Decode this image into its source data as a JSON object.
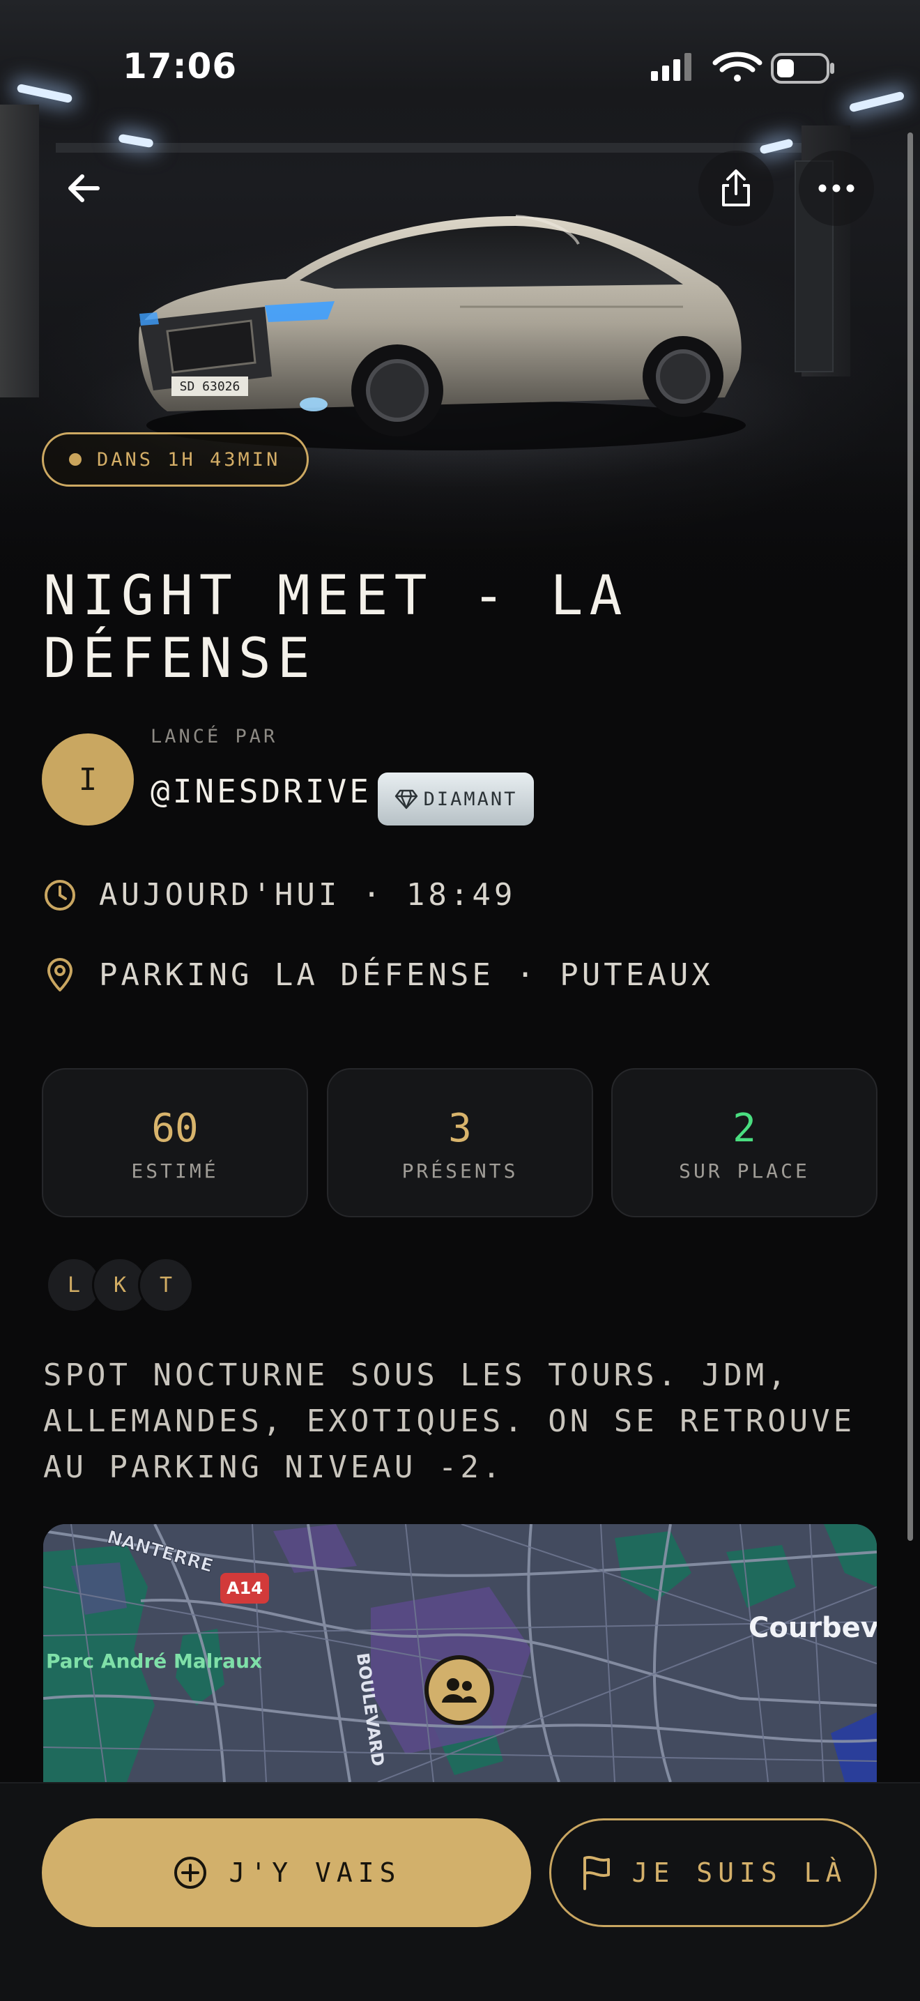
{
  "status_bar": {
    "time": "17:06"
  },
  "hero": {
    "plate": "SD 63026",
    "countdown": "DANS 1H 43MIN"
  },
  "event": {
    "title": "NIGHT MEET - LA DÉFENSE",
    "launched_by_label": "LANCÉ PAR",
    "organizer_initial": "I",
    "organizer_handle": "@INESDRIVE",
    "organizer_badge": "DIAMANT",
    "datetime": "AUJOURD'HUI · 18:49",
    "location": "PARKING LA DÉFENSE · PUTEAUX",
    "description": "SPOT NOCTURNE SOUS LES TOURS. JDM, ALLEMANDES, EXOTIQUES. ON SE RETROUVE AU PARKING NIVEAU -2."
  },
  "stats": [
    {
      "value": "60",
      "label": "ESTIMÉ",
      "color": "#d8b46c"
    },
    {
      "value": "3",
      "label": "PRÉSENTS",
      "color": "#d8b46c"
    },
    {
      "value": "2",
      "label": "SUR PLACE",
      "color": "#4ade80"
    }
  ],
  "attendees": [
    "L",
    "K",
    "T"
  ],
  "map": {
    "labels": {
      "nanterre": "NANTERRE",
      "road": "A14",
      "park": "Parc André Malraux",
      "boulevard": "BOULEVARD",
      "city": "Courbev"
    }
  },
  "actions": {
    "go": "J'Y VAIS",
    "here": "JE SUIS LÀ"
  },
  "colors": {
    "accent": "#d2b06b",
    "background": "#0a0a0b",
    "present_green": "#4ade80"
  }
}
